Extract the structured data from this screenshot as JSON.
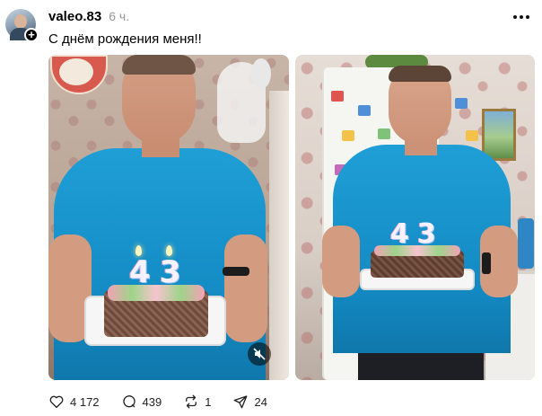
{
  "post": {
    "username": "valeo.83",
    "time": "6 ч.",
    "caption": "С днём рождения меня!!"
  },
  "photos": [
    {
      "id": "left",
      "candle_digits": [
        "4",
        "3"
      ],
      "has_video_mute": true
    },
    {
      "id": "right",
      "candle_digits": [
        "4",
        "3"
      ],
      "has_video_mute": false
    }
  ],
  "actions": {
    "likes": "4 172",
    "comments": "439",
    "reposts": "1",
    "shares": "24"
  },
  "icons": {
    "like": "heart-icon",
    "comment": "speech-bubble-icon",
    "repost": "repost-arrows-icon",
    "share": "paper-plane-icon",
    "more": "more-dots-icon",
    "mute": "muted-speaker-icon",
    "follow": "plus-icon"
  },
  "colors": {
    "shirt": "#1389c2",
    "text": "#000000",
    "muted_text": "#999999"
  }
}
